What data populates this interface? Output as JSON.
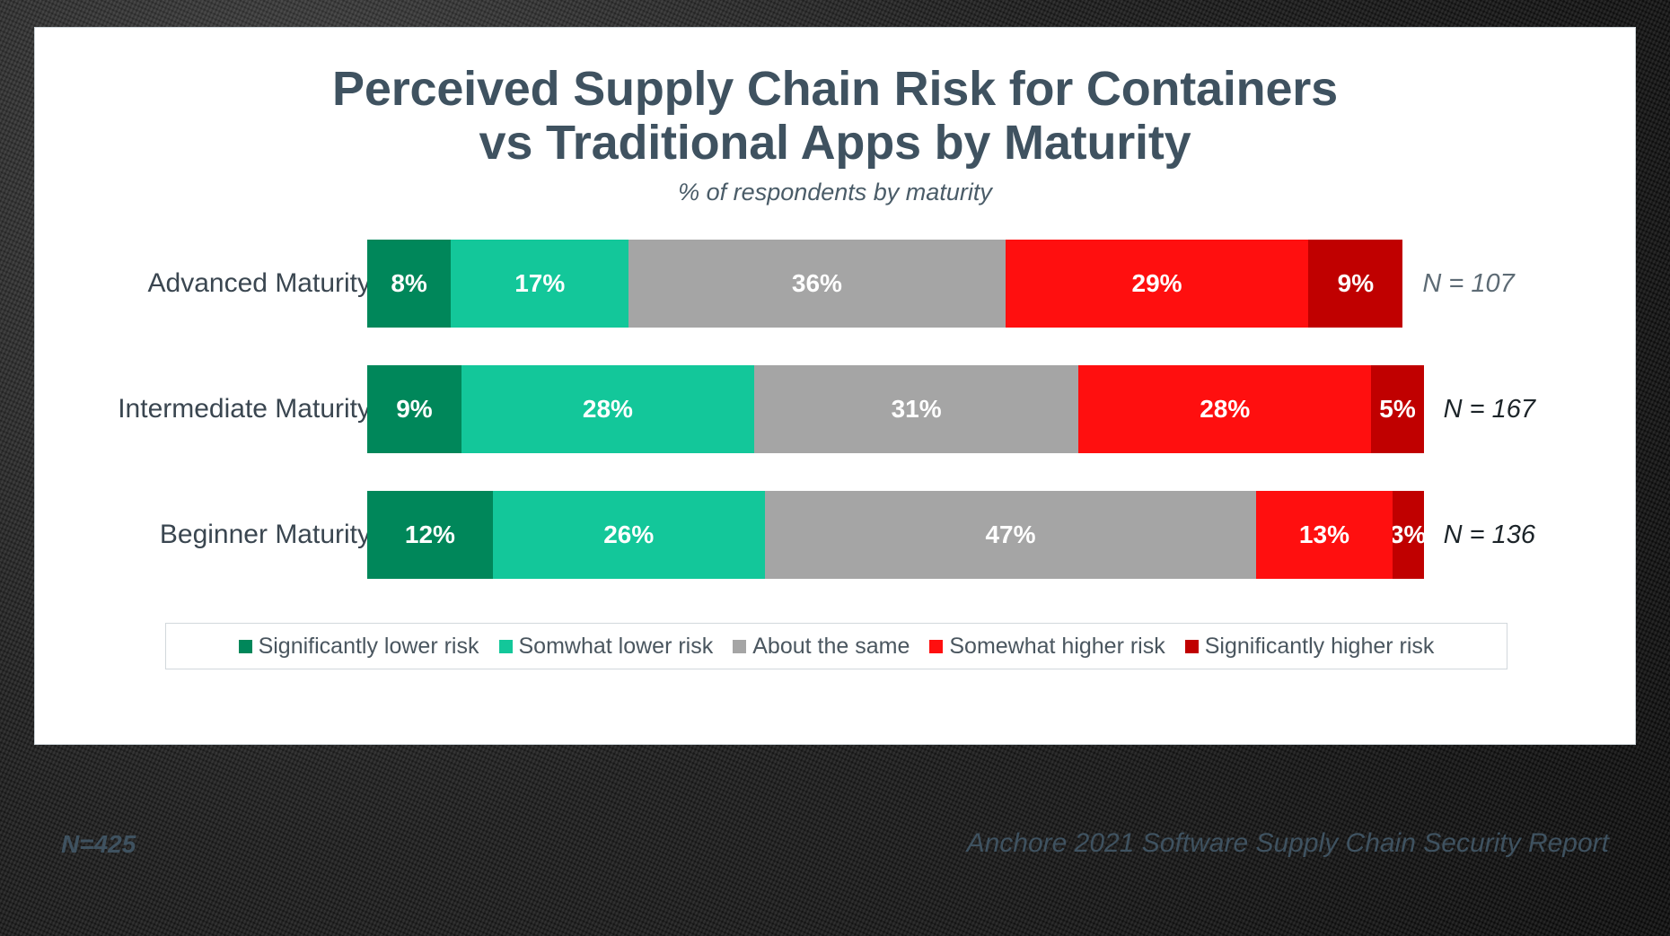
{
  "header": {
    "title_line1": "Perceived Supply Chain Risk for Containers",
    "title_line2": "vs Traditional Apps by Maturity",
    "subtitle": "% of respondents by maturity"
  },
  "footer": {
    "left": "N=425",
    "right": "Anchore 2021 Software Supply Chain Security Report"
  },
  "chart_data": {
    "type": "bar",
    "orientation": "horizontal",
    "stacked": true,
    "normalized": true,
    "title": "Perceived Supply Chain Risk for Containers vs Traditional Apps by Maturity",
    "subtitle": "% of respondents by maturity",
    "xlabel": "",
    "ylabel": "",
    "xlim": [
      0,
      100
    ],
    "grid": false,
    "legend_position": "bottom",
    "value_suffix": "%",
    "categories": [
      "Advanced Maturity",
      "Intermediate Maturity",
      "Beginner Maturity"
    ],
    "category_counts": [
      "N = 107",
      "N = 167",
      "N = 136"
    ],
    "series": [
      {
        "name": "Significantly lower risk",
        "color": "#00875A",
        "values": [
          8,
          9,
          12
        ]
      },
      {
        "name": "Somwhat lower risk",
        "color": "#13C79A",
        "values": [
          17,
          28,
          26
        ]
      },
      {
        "name": "About the same",
        "color": "#A5A5A5",
        "values": [
          36,
          31,
          47
        ]
      },
      {
        "name": "Somewhat higher risk",
        "color": "#FF0F0F",
        "values": [
          29,
          28,
          13
        ]
      },
      {
        "name": "Significantly higher risk",
        "color": "#C00000",
        "values": [
          9,
          5,
          3
        ]
      }
    ],
    "rows": [
      {
        "category": "Advanced Maturity",
        "n_label": "N = 107",
        "segments": [
          {
            "label": "8%",
            "value": 8,
            "series": "Significantly lower risk",
            "color": "#00875A"
          },
          {
            "label": "17%",
            "value": 17,
            "series": "Somwhat lower risk",
            "color": "#13C79A"
          },
          {
            "label": "36%",
            "value": 36,
            "series": "About the same",
            "color": "#A5A5A5"
          },
          {
            "label": "29%",
            "value": 29,
            "series": "Somewhat higher risk",
            "color": "#FF0F0F"
          },
          {
            "label": "9%",
            "value": 9,
            "series": "Significantly higher risk",
            "color": "#C00000"
          }
        ]
      },
      {
        "category": "Intermediate Maturity",
        "n_label": "N = 167",
        "segments": [
          {
            "label": "9%",
            "value": 9,
            "series": "Significantly lower risk",
            "color": "#00875A"
          },
          {
            "label": "28%",
            "value": 28,
            "series": "Somwhat lower risk",
            "color": "#13C79A"
          },
          {
            "label": "31%",
            "value": 31,
            "series": "About the same",
            "color": "#A5A5A5"
          },
          {
            "label": "28%",
            "value": 28,
            "series": "Somewhat higher risk",
            "color": "#FF0F0F"
          },
          {
            "label": "5%",
            "value": 5,
            "series": "Significantly higher risk",
            "color": "#C00000"
          }
        ]
      },
      {
        "category": "Beginner Maturity",
        "n_label": "N = 136",
        "segments": [
          {
            "label": "12%",
            "value": 12,
            "series": "Significantly lower risk",
            "color": "#00875A"
          },
          {
            "label": "26%",
            "value": 26,
            "series": "Somwhat lower risk",
            "color": "#13C79A"
          },
          {
            "label": "47%",
            "value": 47,
            "series": "About the same",
            "color": "#A5A5A5"
          },
          {
            "label": "13%",
            "value": 13,
            "series": "Somewhat higher risk",
            "color": "#FF0F0F"
          },
          {
            "label": "3%",
            "value": 3,
            "series": "Significantly higher risk",
            "color": "#C00000"
          }
        ]
      }
    ],
    "legend": [
      {
        "label": "Significantly lower risk",
        "color": "#00875A"
      },
      {
        "label": "Somwhat lower risk",
        "color": "#13C79A"
      },
      {
        "label": "About the same",
        "color": "#A5A5A5"
      },
      {
        "label": "Somewhat higher risk",
        "color": "#FF0F0F"
      },
      {
        "label": "Significantly higher risk",
        "color": "#C00000"
      }
    ]
  },
  "colors": {
    "title": "#3F5260",
    "card_background": "#FFFFFF",
    "frame": "#1B1B1B"
  }
}
